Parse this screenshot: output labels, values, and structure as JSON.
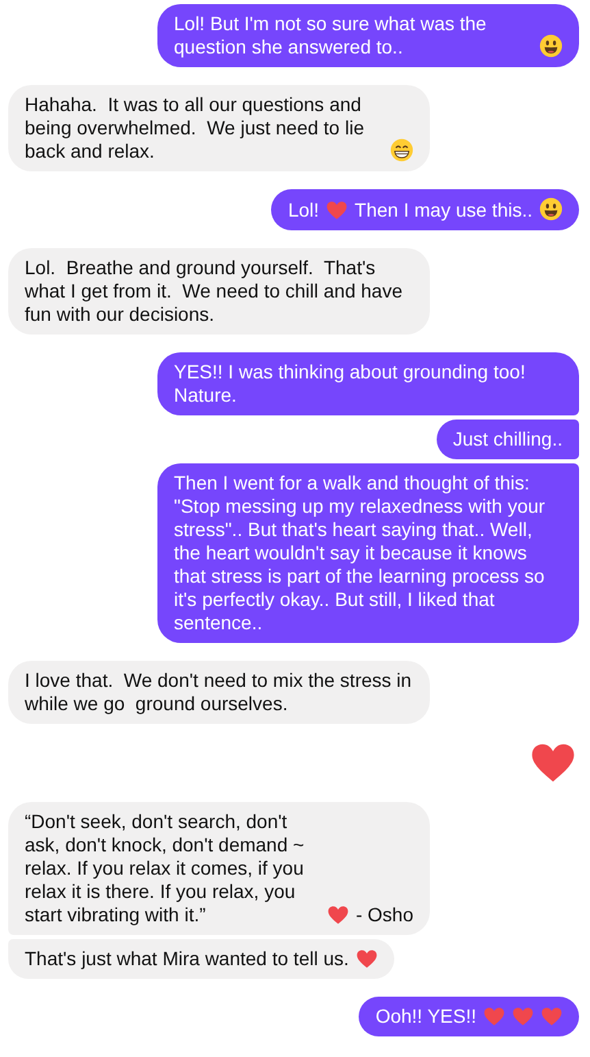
{
  "messages": [
    {
      "sent": true,
      "kind": "bubble",
      "parts": [
        {
          "kind": "text",
          "text": "Lol! But I'm not so sure what was the question she answered to.."
        },
        {
          "kind": "smiley"
        }
      ]
    },
    {
      "sent": false,
      "kind": "bubble",
      "parts": [
        {
          "kind": "text",
          "text": "Hahaha.  It was to all our questions and being overwhelmed.  We just need to lie back and relax."
        },
        {
          "kind": "grin"
        }
      ]
    },
    {
      "sent": true,
      "kind": "bubble",
      "parts": [
        {
          "kind": "text",
          "text": "Lol!"
        },
        {
          "kind": "heart"
        },
        {
          "kind": "text",
          "text": "Then I may use this.."
        },
        {
          "kind": "smiley"
        }
      ]
    },
    {
      "sent": false,
      "kind": "bubble",
      "parts": [
        {
          "kind": "text",
          "text": "Lol.  Breathe and ground yourself.  That's what I get from it.  We need to chill and have fun with our decisions."
        }
      ]
    },
    {
      "sent": true,
      "kind": "bubble",
      "parts": [
        {
          "kind": "text",
          "text": "YES!! I was thinking about grounding too! Nature."
        }
      ]
    },
    {
      "sent": true,
      "kind": "bubble",
      "parts": [
        {
          "kind": "text",
          "text": "Just chilling.."
        }
      ]
    },
    {
      "sent": true,
      "kind": "bubble",
      "parts": [
        {
          "kind": "text",
          "text": "Then I went for a walk and thought of this: \"Stop messing up my relaxedness with your stress\".. But that's heart saying that.. Well, the heart wouldn't say it because it knows that stress is part of the learning process so it's perfectly okay.. But still, I liked that sentence.."
        }
      ]
    },
    {
      "sent": false,
      "kind": "bubble",
      "parts": [
        {
          "kind": "text",
          "text": "I love that.  We don't need to mix the stress in while we go  ground ourselves."
        }
      ]
    },
    {
      "kind": "big_heart"
    },
    {
      "sent": false,
      "kind": "bubble",
      "parts": [
        {
          "kind": "text",
          "text": "“Don't seek, don't search, don't ask, don't knock, don't demand ~ relax. If you relax it comes, if you relax it is there. If you relax, you start vibrating with it.”"
        },
        {
          "kind": "heart"
        },
        {
          "kind": "text",
          "text": "- Osho"
        }
      ]
    },
    {
      "sent": false,
      "kind": "bubble",
      "parts": [
        {
          "kind": "text",
          "text": "That's just what Mira wanted to tell us."
        },
        {
          "kind": "heart"
        }
      ]
    },
    {
      "sent": true,
      "kind": "bubble",
      "parts": [
        {
          "kind": "text",
          "text": "Ooh!! YES!!"
        },
        {
          "kind": "heart"
        },
        {
          "kind": "heart"
        },
        {
          "kind": "heart"
        }
      ]
    }
  ]
}
